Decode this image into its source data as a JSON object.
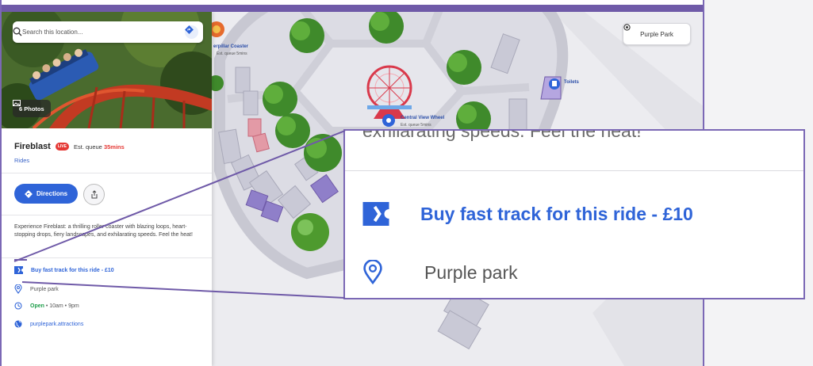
{
  "search": {
    "placeholder": "Search this location..."
  },
  "map": {
    "park_button": "Purple Park",
    "labels": {
      "caterpillar": "erpillar Coaster",
      "caterpillar_queue": "Est. queue 5mins",
      "wheel": "Central View Wheel",
      "wheel_queue": "Est. queue 5mins",
      "toilets": "Toilets"
    }
  },
  "attraction": {
    "photos_label": "6 Photos",
    "name": "Fireblast",
    "live_badge": "LIVE",
    "queue_prefix": "Est. queue",
    "queue_value": "35mins",
    "category": "Rides",
    "directions_label": "Directions",
    "description": "Experience Fireblast: a thrilling roller coaster with blazing loops, heart-stopping drops, fiery landscapes, and exhilarating speeds. Feel the heat!",
    "fast_track": "Buy fast track for this ride - £10",
    "location": "Purple park",
    "open_status": "Open",
    "hours": " • 10am • 9pm",
    "website": "purplepark.attractions"
  },
  "zoom": {
    "cut_text": "exhilarating speeds. Feel the heat!",
    "fast_track": "Buy fast track for this ride - £10",
    "location": "Purple park"
  },
  "colors": {
    "accent": "#2f64d8",
    "frame": "#7b68b5",
    "live": "#e53935",
    "open": "#1e9e4a"
  }
}
